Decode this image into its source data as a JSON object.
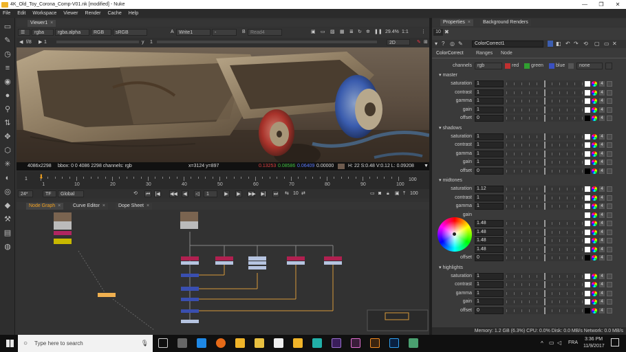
{
  "window": {
    "title": "4K_Old_Toy_Corona_Comp-V01.nk [modified] - Nuke",
    "min": "—",
    "max": "❐",
    "close": "✕"
  },
  "menu": [
    "File",
    "Edit",
    "Workspace",
    "Viewer",
    "Render",
    "Cache",
    "Help"
  ],
  "viewer": {
    "tab": "Viewer1",
    "channels": "rgba",
    "channel_alpha": "rgba.alpha",
    "colorspace_a": "RGB",
    "colorspace_b": "sRGB",
    "input_a_label": "A",
    "input_a": "Write1",
    "input_a_op": "-",
    "input_b_label": "B",
    "input_b": "Read4",
    "zoom": "29.4%",
    "ratio": "1:1",
    "mode": "2D",
    "frame_step": "f/8",
    "frame": "1",
    "y": "y",
    "y_val": "1"
  },
  "infobar": {
    "res": "4086x2298",
    "bbox": "bbox: 0 0 4086 2298 channels: rgb",
    "coords": "x=3124 y=897",
    "r": "0.13253",
    "g": "0.08586",
    "b": "0.06409",
    "a": "0.00000",
    "hsv": "H: 22 S:0.48 V:0.12  L: 0.09208"
  },
  "timeline": {
    "labels": [
      "1",
      "10",
      "20",
      "30",
      "40",
      "50",
      "60",
      "70",
      "80",
      "90",
      "100"
    ],
    "end_field": "100",
    "start_field": "1"
  },
  "transport": {
    "fps": "24*",
    "tf": "TF",
    "scope": "Global",
    "frame": "1",
    "step": "10",
    "end": "100"
  },
  "nodegraph_tabs": [
    "Node Graph",
    "Curve Editor",
    "Dope Sheet"
  ],
  "properties": {
    "tabs": [
      "Properties",
      "Background Renders"
    ],
    "max_count": "10",
    "node_name": "ColorCorrect1",
    "subtabs": [
      "ColorCorrect",
      "Ranges",
      "Node"
    ],
    "channels_label": "channels",
    "channels_value": "rgb",
    "ch_red": "red",
    "ch_green": "green",
    "ch_blue": "blue",
    "ch_none": "none",
    "sections": [
      {
        "name": "master",
        "rows": [
          {
            "label": "saturation",
            "value": "1"
          },
          {
            "label": "contrast",
            "value": "1"
          },
          {
            "label": "gamma",
            "value": "1"
          },
          {
            "label": "gain",
            "value": "1"
          },
          {
            "label": "offset",
            "value": "0"
          }
        ]
      },
      {
        "name": "shadows",
        "rows": [
          {
            "label": "saturation",
            "value": "1"
          },
          {
            "label": "contrast",
            "value": "1"
          },
          {
            "label": "gamma",
            "value": "1"
          },
          {
            "label": "gain",
            "value": "1"
          },
          {
            "label": "offset",
            "value": "0"
          }
        ]
      },
      {
        "name": "midtones",
        "rows": [
          {
            "label": "saturation",
            "value": "1.12"
          },
          {
            "label": "contrast",
            "value": "1"
          },
          {
            "label": "gamma",
            "value": "1"
          },
          {
            "label": "gain",
            "value": ""
          },
          {
            "label": "",
            "value": "1.48"
          },
          {
            "label": "",
            "value": "1.48"
          },
          {
            "label": "",
            "value": "1.48"
          },
          {
            "label": "",
            "value": "1.48"
          },
          {
            "label": "offset",
            "value": "0"
          }
        ]
      },
      {
        "name": "highlights",
        "rows": [
          {
            "label": "saturation",
            "value": "1"
          },
          {
            "label": "contrast",
            "value": "1"
          },
          {
            "label": "gamma",
            "value": "1"
          },
          {
            "label": "gain",
            "value": "1"
          },
          {
            "label": "offset",
            "value": "0"
          }
        ]
      }
    ],
    "anim_num": "4"
  },
  "status": "Memory: 1.2 GB (6.3%)  CPU: 0.0%  Disk: 0.0 MB/s  Network: 0.0 MB/s",
  "taskbar": {
    "search": "Type here to search",
    "lang": "FRA",
    "time": "3:36 PM",
    "date": "11/9/2017"
  }
}
